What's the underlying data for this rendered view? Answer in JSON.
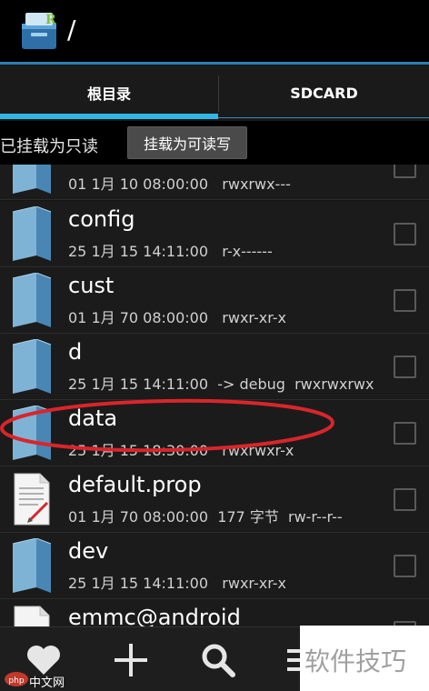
{
  "header": {
    "path": "/"
  },
  "tabs": [
    {
      "label": "根目录"
    },
    {
      "label": "SDCARD"
    }
  ],
  "mount": {
    "status": "已挂载为只读",
    "button": "挂载为可读写"
  },
  "files": [
    {
      "name": "",
      "meta": "01 1月 10 08:00:00   rwxrwx---",
      "type": "folder"
    },
    {
      "name": "config",
      "meta": "25 1月 15 14:11:00   r-x------",
      "type": "folder"
    },
    {
      "name": "cust",
      "meta": "01 1月 70 08:00:00   rwxr-xr-x",
      "type": "folder"
    },
    {
      "name": "d",
      "meta": "25 1月 15 14:11:00  -> debug  rwxrwxrwx",
      "type": "folder"
    },
    {
      "name": "data",
      "meta": "25 1月 15 18:30:00   rwxrwxr-x",
      "type": "folder"
    },
    {
      "name": "default.prop",
      "meta": "01 1月 70 08:00:00  177 字节  rw-r--r--",
      "type": "file"
    },
    {
      "name": "dev",
      "meta": "25 1月 15 14:11:00   rwxr-xr-x",
      "type": "folder"
    },
    {
      "name": "emmc@android",
      "meta": "",
      "type": "file"
    }
  ],
  "watermark": {
    "text": "软件技巧",
    "site": "中文网"
  },
  "colors": {
    "accent": "#33b5e5",
    "highlight": "#d9252b"
  }
}
